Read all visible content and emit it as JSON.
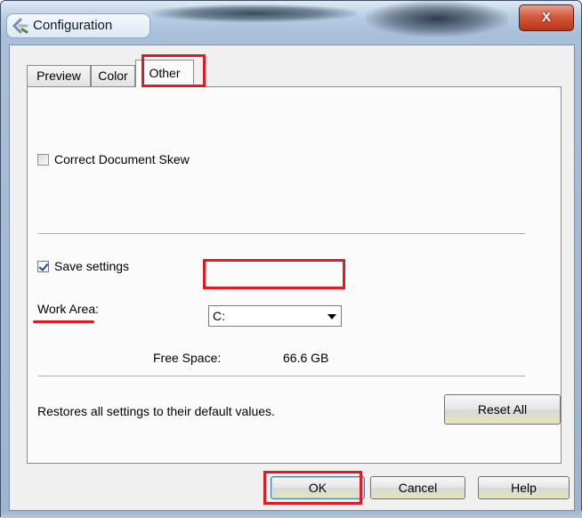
{
  "window": {
    "title": "Configuration",
    "close_label": "X"
  },
  "tabs": [
    {
      "label": "Preview",
      "active": false
    },
    {
      "label": "Color",
      "active": false
    },
    {
      "label": "Other",
      "active": true
    }
  ],
  "other_tab": {
    "correct_skew": {
      "label": "Correct Document Skew",
      "checked": false
    },
    "save_settings": {
      "label": "Save settings",
      "checked": true
    },
    "work_area": {
      "label": "Work Area:",
      "value": "C:"
    },
    "free_space": {
      "label": "Free Space:",
      "value": "66.6 GB"
    },
    "restore_text": "Restores all settings to their default values.",
    "reset_all_label": "Reset All"
  },
  "footer": {
    "ok_label": "OK",
    "cancel_label": "Cancel",
    "help_label": "Help"
  },
  "colors": {
    "highlight": "#e01b24",
    "close_button": "#c8482c"
  }
}
